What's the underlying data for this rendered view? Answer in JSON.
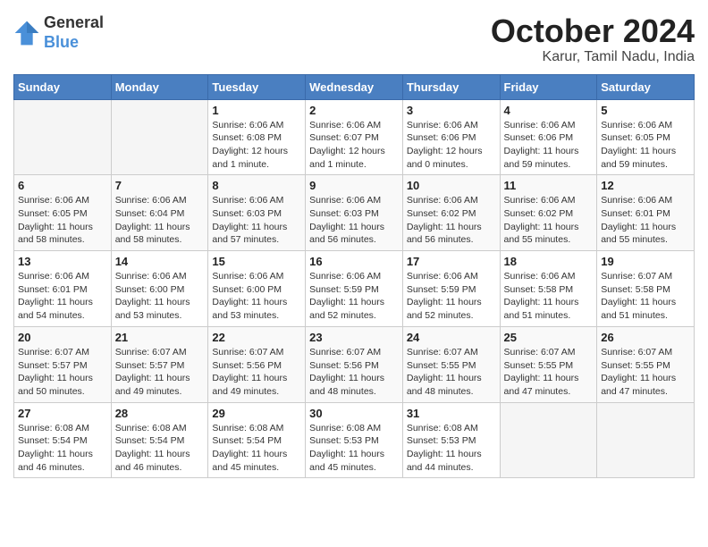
{
  "header": {
    "logo_line1": "General",
    "logo_line2": "Blue",
    "month_year": "October 2024",
    "location": "Karur, Tamil Nadu, India"
  },
  "days_of_week": [
    "Sunday",
    "Monday",
    "Tuesday",
    "Wednesday",
    "Thursday",
    "Friday",
    "Saturday"
  ],
  "weeks": [
    [
      {
        "day": "",
        "info": ""
      },
      {
        "day": "",
        "info": ""
      },
      {
        "day": "1",
        "info": "Sunrise: 6:06 AM\nSunset: 6:08 PM\nDaylight: 12 hours\nand 1 minute."
      },
      {
        "day": "2",
        "info": "Sunrise: 6:06 AM\nSunset: 6:07 PM\nDaylight: 12 hours\nand 1 minute."
      },
      {
        "day": "3",
        "info": "Sunrise: 6:06 AM\nSunset: 6:06 PM\nDaylight: 12 hours\nand 0 minutes."
      },
      {
        "day": "4",
        "info": "Sunrise: 6:06 AM\nSunset: 6:06 PM\nDaylight: 11 hours\nand 59 minutes."
      },
      {
        "day": "5",
        "info": "Sunrise: 6:06 AM\nSunset: 6:05 PM\nDaylight: 11 hours\nand 59 minutes."
      }
    ],
    [
      {
        "day": "6",
        "info": "Sunrise: 6:06 AM\nSunset: 6:05 PM\nDaylight: 11 hours\nand 58 minutes."
      },
      {
        "day": "7",
        "info": "Sunrise: 6:06 AM\nSunset: 6:04 PM\nDaylight: 11 hours\nand 58 minutes."
      },
      {
        "day": "8",
        "info": "Sunrise: 6:06 AM\nSunset: 6:03 PM\nDaylight: 11 hours\nand 57 minutes."
      },
      {
        "day": "9",
        "info": "Sunrise: 6:06 AM\nSunset: 6:03 PM\nDaylight: 11 hours\nand 56 minutes."
      },
      {
        "day": "10",
        "info": "Sunrise: 6:06 AM\nSunset: 6:02 PM\nDaylight: 11 hours\nand 56 minutes."
      },
      {
        "day": "11",
        "info": "Sunrise: 6:06 AM\nSunset: 6:02 PM\nDaylight: 11 hours\nand 55 minutes."
      },
      {
        "day": "12",
        "info": "Sunrise: 6:06 AM\nSunset: 6:01 PM\nDaylight: 11 hours\nand 55 minutes."
      }
    ],
    [
      {
        "day": "13",
        "info": "Sunrise: 6:06 AM\nSunset: 6:01 PM\nDaylight: 11 hours\nand 54 minutes."
      },
      {
        "day": "14",
        "info": "Sunrise: 6:06 AM\nSunset: 6:00 PM\nDaylight: 11 hours\nand 53 minutes."
      },
      {
        "day": "15",
        "info": "Sunrise: 6:06 AM\nSunset: 6:00 PM\nDaylight: 11 hours\nand 53 minutes."
      },
      {
        "day": "16",
        "info": "Sunrise: 6:06 AM\nSunset: 5:59 PM\nDaylight: 11 hours\nand 52 minutes."
      },
      {
        "day": "17",
        "info": "Sunrise: 6:06 AM\nSunset: 5:59 PM\nDaylight: 11 hours\nand 52 minutes."
      },
      {
        "day": "18",
        "info": "Sunrise: 6:06 AM\nSunset: 5:58 PM\nDaylight: 11 hours\nand 51 minutes."
      },
      {
        "day": "19",
        "info": "Sunrise: 6:07 AM\nSunset: 5:58 PM\nDaylight: 11 hours\nand 51 minutes."
      }
    ],
    [
      {
        "day": "20",
        "info": "Sunrise: 6:07 AM\nSunset: 5:57 PM\nDaylight: 11 hours\nand 50 minutes."
      },
      {
        "day": "21",
        "info": "Sunrise: 6:07 AM\nSunset: 5:57 PM\nDaylight: 11 hours\nand 49 minutes."
      },
      {
        "day": "22",
        "info": "Sunrise: 6:07 AM\nSunset: 5:56 PM\nDaylight: 11 hours\nand 49 minutes."
      },
      {
        "day": "23",
        "info": "Sunrise: 6:07 AM\nSunset: 5:56 PM\nDaylight: 11 hours\nand 48 minutes."
      },
      {
        "day": "24",
        "info": "Sunrise: 6:07 AM\nSunset: 5:55 PM\nDaylight: 11 hours\nand 48 minutes."
      },
      {
        "day": "25",
        "info": "Sunrise: 6:07 AM\nSunset: 5:55 PM\nDaylight: 11 hours\nand 47 minutes."
      },
      {
        "day": "26",
        "info": "Sunrise: 6:07 AM\nSunset: 5:55 PM\nDaylight: 11 hours\nand 47 minutes."
      }
    ],
    [
      {
        "day": "27",
        "info": "Sunrise: 6:08 AM\nSunset: 5:54 PM\nDaylight: 11 hours\nand 46 minutes."
      },
      {
        "day": "28",
        "info": "Sunrise: 6:08 AM\nSunset: 5:54 PM\nDaylight: 11 hours\nand 46 minutes."
      },
      {
        "day": "29",
        "info": "Sunrise: 6:08 AM\nSunset: 5:54 PM\nDaylight: 11 hours\nand 45 minutes."
      },
      {
        "day": "30",
        "info": "Sunrise: 6:08 AM\nSunset: 5:53 PM\nDaylight: 11 hours\nand 45 minutes."
      },
      {
        "day": "31",
        "info": "Sunrise: 6:08 AM\nSunset: 5:53 PM\nDaylight: 11 hours\nand 44 minutes."
      },
      {
        "day": "",
        "info": ""
      },
      {
        "day": "",
        "info": ""
      }
    ]
  ]
}
